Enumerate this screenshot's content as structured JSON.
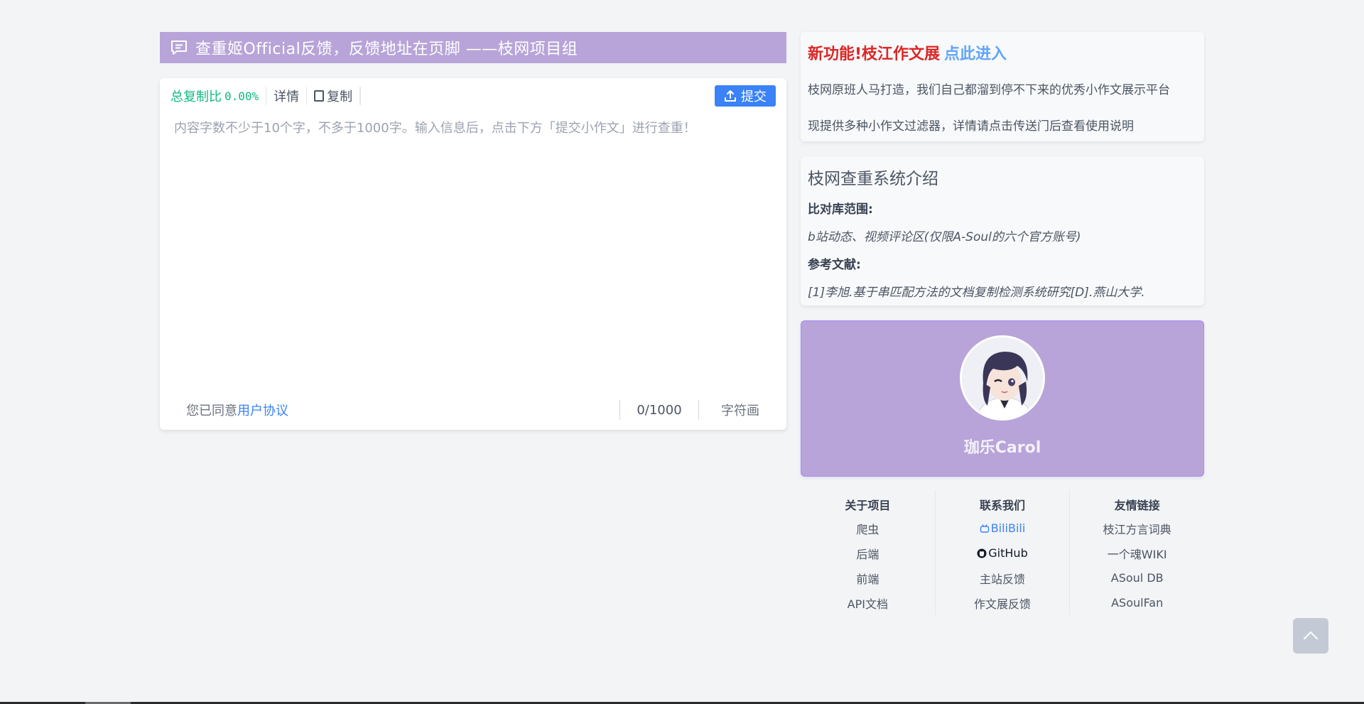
{
  "banner": {
    "text": "查重姬Official反馈，反馈地址在页脚 ——枝网项目组",
    "icon": "comment-icon"
  },
  "editor": {
    "ratio_label": "总复制比",
    "ratio_value": "0.00%",
    "details_label": "详情",
    "copy_label": "复制",
    "submit_label": "提交",
    "placeholder": "内容字数不少于10个字，不多于1000字。输入信息后，点击下方「提交小作文」进行查重！",
    "agree_prefix": "您已同意",
    "agree_link": "用户协议",
    "counter": "0/1000",
    "char_pic": "字符画"
  },
  "new_feature": {
    "title_red": "新功能!枝江作文展",
    "title_link": "点此进入",
    "line1": "枝网原班人马打造，我们自己都溜到停不下来的优秀小作文展示平台",
    "line2": "现提供多种小作文过滤器，详情请点击传送门后查看使用说明"
  },
  "intro": {
    "title": "枝网查重系统介绍",
    "scope_label": "比对库范围:",
    "scope_text": "b站动态、视频评论区(仅限A-Soul的六个官方账号)",
    "ref_label": "参考文献:",
    "ref_text": "[1]李旭.基于串匹配方法的文档复制检测系统研究[D].燕山大学."
  },
  "profile": {
    "name": "珈乐Carol"
  },
  "footer": {
    "about": {
      "title": "关于项目",
      "links": [
        "爬虫",
        "后端",
        "前端",
        "API文档"
      ]
    },
    "contact": {
      "title": "联系我们",
      "bilibili": "BiliBili",
      "github": "GitHub",
      "links": [
        "主站反馈",
        "作文展反馈"
      ]
    },
    "friends": {
      "title": "友情链接",
      "links": [
        "枝江方言词典",
        "一个魂WIKI",
        "ASoul DB",
        "ASoulFan"
      ]
    }
  },
  "colors": {
    "accent_purple": "#b8a4d8",
    "primary_blue": "#3b82f6",
    "ratio_green": "#10b981",
    "title_red": "#dc2626"
  }
}
